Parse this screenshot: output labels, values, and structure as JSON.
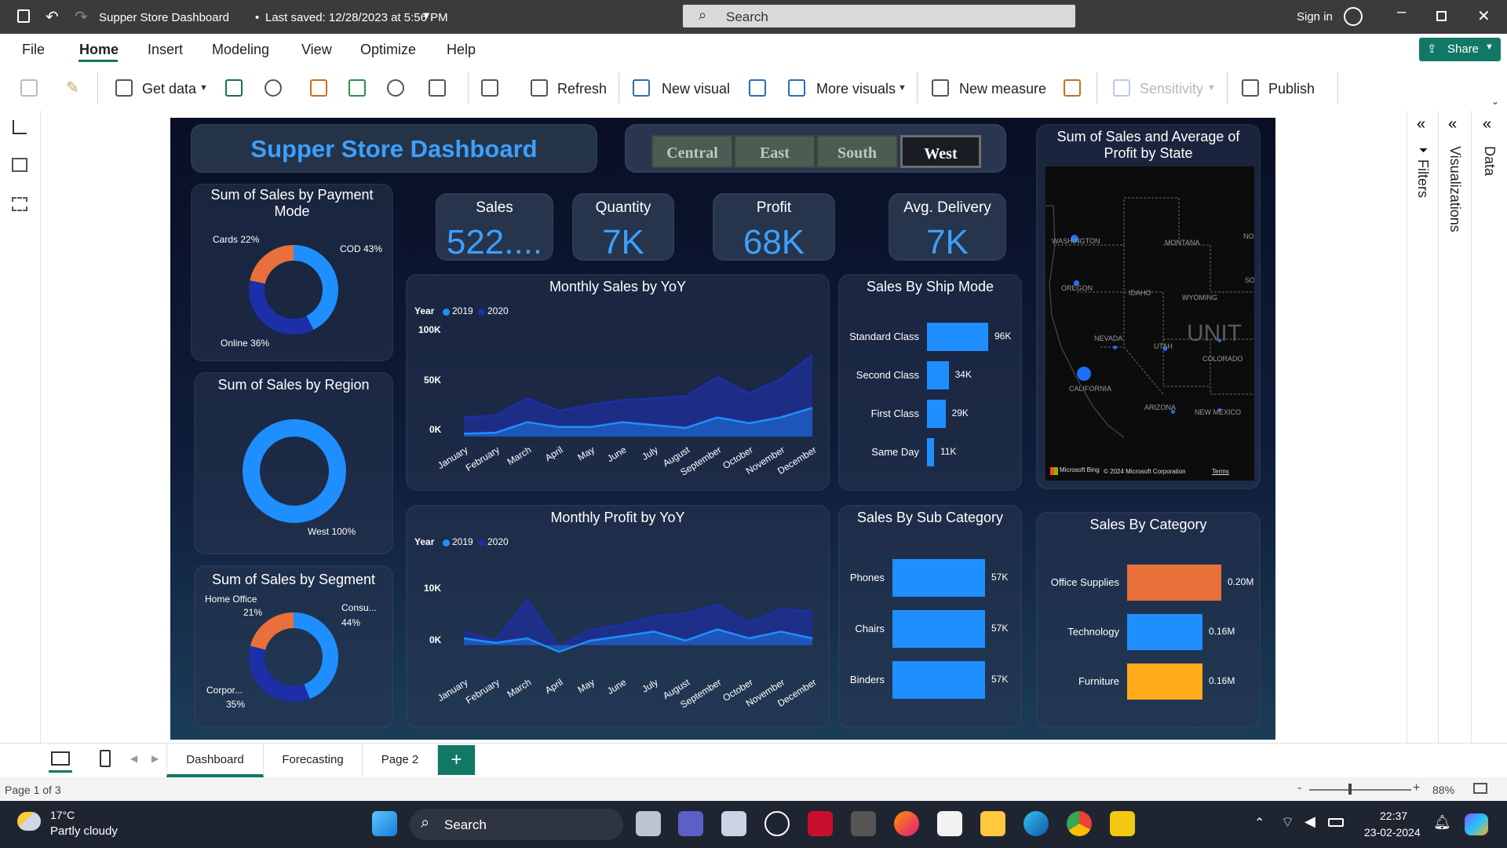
{
  "window": {
    "title": "Supper Store Dashboard",
    "saved": "Last saved: 12/28/2023 at 5:56 PM",
    "search_placeholder": "Search",
    "sign_in": "Sign in"
  },
  "menu": [
    "File",
    "Home",
    "Insert",
    "Modeling",
    "View",
    "Optimize",
    "Help"
  ],
  "share_label": "Share",
  "ribbon": {
    "get_data": "Get data",
    "refresh": "Refresh",
    "new_visual": "New visual",
    "more_visuals": "More visuals",
    "new_measure": "New measure",
    "sensitivity": "Sensitivity",
    "publish": "Publish"
  },
  "dashboard": {
    "title": "Supper Store Dashboard",
    "slicers": [
      "Central",
      "East",
      "South",
      "West"
    ],
    "selected_slicer": "West",
    "kpis": [
      {
        "label": "Sales",
        "value": "522...."
      },
      {
        "label": "Quantity",
        "value": "7K"
      },
      {
        "label": "Profit",
        "value": "68K"
      },
      {
        "label": "Avg. Delivery",
        "value": "7K"
      }
    ],
    "payment_title": "Sum of Sales by Payment Mode",
    "payment_labels": [
      "Cards 22%",
      "COD 43%",
      "Online 36%"
    ],
    "region_title": "Sum of Sales by Region",
    "region_label": "West 100%",
    "segment_title": "Sum of Sales by Segment",
    "segment_labels": {
      "home": "Home Office",
      "home_pct": "21%",
      "cons": "Consu...",
      "cons_pct": "44%",
      "corp": "Corpor...",
      "corp_pct": "35%"
    },
    "monthly_sales_title": "Monthly Sales by YoY",
    "monthly_profit_title": "Monthly Profit by YoY",
    "legend_year": "Year",
    "legend_2019": "2019",
    "legend_2020": "2020",
    "months": [
      "January",
      "February",
      "March",
      "April",
      "May",
      "June",
      "July",
      "August",
      "September",
      "October",
      "November",
      "December"
    ],
    "sales_ticks": [
      "100K",
      "50K",
      "0K"
    ],
    "profit_ticks": [
      "10K",
      "0K"
    ],
    "ship_title": "Sales By Ship Mode",
    "ship": [
      {
        "label": "Standard Class",
        "value": "96K"
      },
      {
        "label": "Second Class",
        "value": "34K"
      },
      {
        "label": "First Class",
        "value": "29K"
      },
      {
        "label": "Same Day",
        "value": "11K"
      }
    ],
    "subcat_title": "Sales By Sub Category",
    "subcat": [
      {
        "label": "Phones",
        "value": "57K"
      },
      {
        "label": "Chairs",
        "value": "57K"
      },
      {
        "label": "Binders",
        "value": "57K"
      }
    ],
    "map_title": "Sum of Sales and Average of Profit by State",
    "map_labels": [
      "WASHINGTON",
      "MONTANA",
      "OREGON",
      "IDAHO",
      "WYOMING",
      "NEVADA",
      "UTAH",
      "COLORADO",
      "CALIFORNIA",
      "ARIZONA",
      "NEW MEXICO",
      "UNIT",
      "NO",
      "SO"
    ],
    "map_credit": "Microsoft Bing",
    "map_copyright": "© 2024 Microsoft Corporation",
    "map_terms": "Terms",
    "category_title": "Sales By Category",
    "category": [
      {
        "label": "Office Supplies",
        "value": "0.20M",
        "color": "#e8703a"
      },
      {
        "label": "Technology",
        "value": "0.16M",
        "color": "#1f8fff"
      },
      {
        "label": "Furniture",
        "value": "0.16M",
        "color": "#ffab1a"
      }
    ]
  },
  "chart_data": [
    {
      "type": "area",
      "title": "Monthly Sales by YoY",
      "categories": [
        "January",
        "February",
        "March",
        "April",
        "May",
        "June",
        "July",
        "August",
        "September",
        "October",
        "November",
        "December"
      ],
      "series": [
        {
          "name": "2019",
          "values": [
            3,
            4,
            15,
            10,
            10,
            15,
            12,
            9,
            20,
            14,
            20,
            30
          ]
        },
        {
          "name": "2020",
          "values": [
            20,
            22,
            40,
            27,
            33,
            38,
            40,
            42,
            62,
            45,
            60,
            85
          ]
        }
      ],
      "ylim": [
        0,
        100
      ],
      "yticks": [
        "100K",
        "50K",
        "0K"
      ]
    },
    {
      "type": "area",
      "title": "Monthly Profit by YoY",
      "categories": [
        "January",
        "February",
        "March",
        "April",
        "May",
        "June",
        "July",
        "August",
        "September",
        "October",
        "November",
        "December"
      ],
      "series": [
        {
          "name": "2019",
          "values": [
            1.5,
            0.5,
            1.5,
            -1.5,
            1,
            2,
            3,
            1,
            3.5,
            1.5,
            3,
            1.5
          ]
        },
        {
          "name": "2020",
          "values": [
            3,
            1,
            10,
            -0.5,
            3.5,
            4.5,
            6.5,
            7,
            9,
            5,
            8,
            7.5
          ]
        }
      ],
      "ylim": [
        -2,
        12
      ],
      "yticks": [
        "10K",
        "0K"
      ]
    },
    {
      "type": "bar",
      "title": "Sales By Ship Mode",
      "categories": [
        "Standard Class",
        "Second Class",
        "First Class",
        "Same Day"
      ],
      "values": [
        96,
        34,
        29,
        11
      ]
    },
    {
      "type": "bar",
      "title": "Sales By Sub Category",
      "categories": [
        "Phones",
        "Chairs",
        "Binders"
      ],
      "values": [
        57,
        57,
        57
      ]
    },
    {
      "type": "bar",
      "title": "Sales By Category",
      "categories": [
        "Office Supplies",
        "Technology",
        "Furniture"
      ],
      "values": [
        0.2,
        0.16,
        0.16
      ]
    },
    {
      "type": "pie",
      "title": "Sum of Sales by Payment Mode",
      "categories": [
        "COD",
        "Online",
        "Cards"
      ],
      "values": [
        43,
        36,
        22
      ]
    },
    {
      "type": "pie",
      "title": "Sum of Sales by Region",
      "categories": [
        "West"
      ],
      "values": [
        100
      ]
    },
    {
      "type": "pie",
      "title": "Sum of Sales by Segment",
      "categories": [
        "Consumer",
        "Corporate",
        "Home Office"
      ],
      "values": [
        44,
        35,
        21
      ]
    }
  ],
  "page_tabs": [
    "Dashboard",
    "Forecasting",
    "Page 2"
  ],
  "status": {
    "page": "Page 1 of 3",
    "zoom": "88%"
  },
  "right_panes": {
    "filters": "Filters",
    "visualizations": "Visualizations",
    "data": "Data"
  },
  "taskbar": {
    "temp": "17°C",
    "weather": "Partly cloudy",
    "search": "Search",
    "time": "22:37",
    "date": "23-02-2024"
  }
}
